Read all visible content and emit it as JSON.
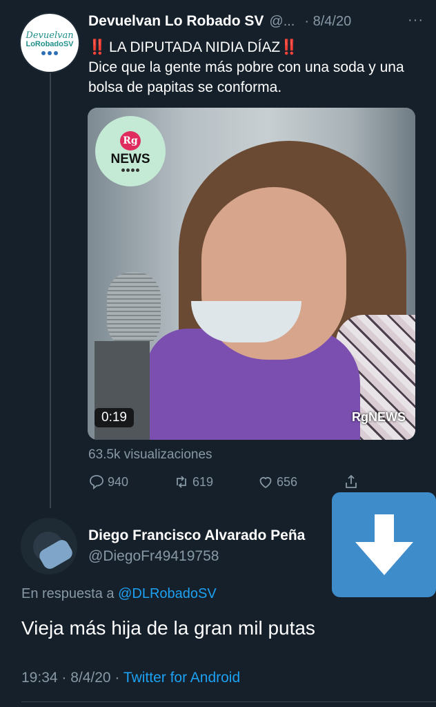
{
  "tweet": {
    "author_name": "Devuelvan Lo Robado SV",
    "author_handle": "@...",
    "date": "· 8/4/20",
    "more": "···",
    "avatar_text_line1": "Devuelvan",
    "avatar_text_line2": "LoRobadoSV",
    "headline_prefix": "‼️",
    "headline": "LA DIPUTADA NIDIA DÍAZ",
    "headline_suffix": "‼️",
    "body": "Dice que la gente más pobre con una soda y una bolsa de papitas se conforma.",
    "media": {
      "logo_rg": "Rg",
      "logo_news": "NEWS",
      "duration": "0:19",
      "watermark": "RgNEWS"
    },
    "views": "63.5k visualizaciones",
    "actions": {
      "replies": "940",
      "retweets": "619",
      "likes": "656"
    }
  },
  "reply": {
    "author_name": "Diego Francisco Alvarado Peña",
    "author_handle": "@DiegoFr49419758",
    "replying_label": "En respuesta a",
    "replying_handle": "@DLRobadoSV",
    "text": "Vieja más hija de la gran mil putas",
    "timestamp": "19:34 · 8/4/20 ·",
    "source": "Twitter for Android"
  },
  "overlay": {
    "download_icon": "arrow-down-icon",
    "accent": "#3f8ccb"
  },
  "colors": {
    "background": "#15202b",
    "muted": "#8899a6",
    "link": "#1da1f2",
    "alert": "#e0245e"
  }
}
